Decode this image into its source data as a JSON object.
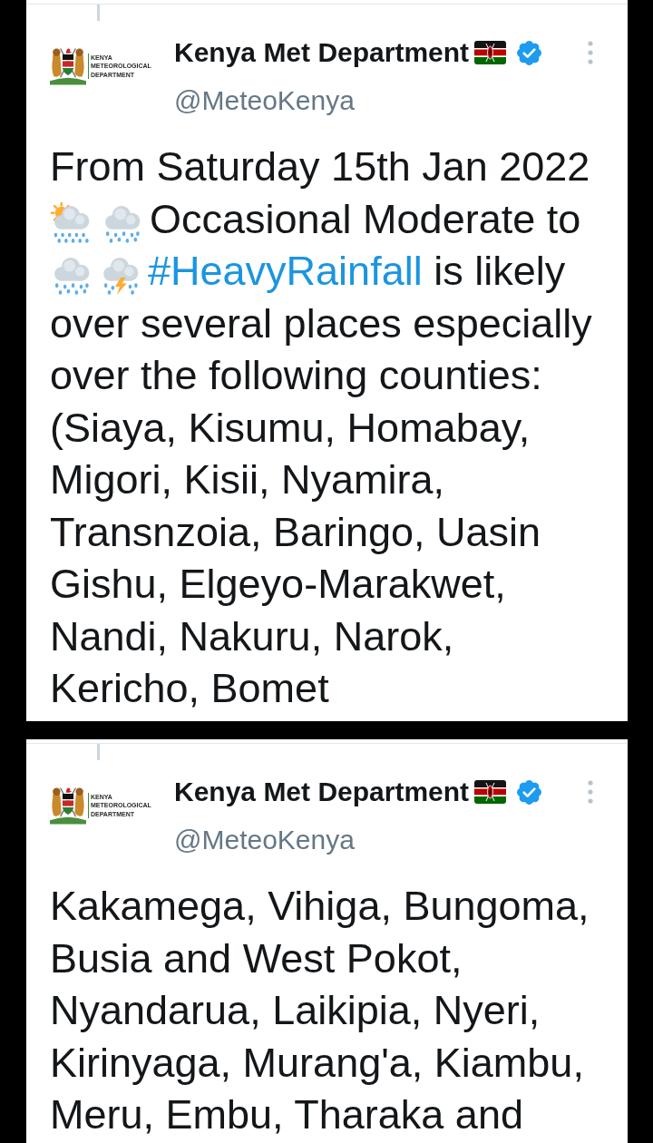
{
  "tweets": [
    {
      "connected_above": true,
      "author": {
        "logo_lines": [
          "KENYA",
          "METEOROLOGICAL",
          "DEPARTMENT"
        ],
        "name": "Kenya Met Department",
        "verified": true,
        "handle": "@MeteoKenya"
      },
      "text": [
        {
          "kind": "text",
          "text": "From Saturday 15th Jan 2022 "
        },
        {
          "kind": "sunshower"
        },
        {
          "kind": "rain"
        },
        {
          "kind": "text",
          "text": "Occasional Moderate to "
        },
        {
          "kind": "rain"
        },
        {
          "kind": "thunderstorm"
        },
        {
          "kind": "hashtag",
          "text": "#HeavyRainfall"
        },
        {
          "kind": "text",
          "text": " is likely over several places especially over the following counties: (Siaya, Kisumu, Homabay, Migori, Kisii, Nyamira, Transnzoia, Baringo, Uasin Gishu, Elgeyo-Marakwet, Nandi, Nakuru, Narok, Kericho, Bomet"
        }
      ]
    },
    {
      "connected_above": true,
      "author": {
        "logo_lines": [
          "KENYA",
          "METEOROLOGICAL",
          "DEPARTMENT"
        ],
        "name": "Kenya Met Department",
        "verified": true,
        "handle": "@MeteoKenya"
      },
      "text": [
        {
          "kind": "text",
          "text": "Kakamega, Vihiga, Bungoma, Busia and West Pokot, Nyandarua, Laikipia, Nyeri, Kirinyaga, Murang'a, Kiambu, Meru, Embu, Tharaka and"
        }
      ]
    }
  ]
}
